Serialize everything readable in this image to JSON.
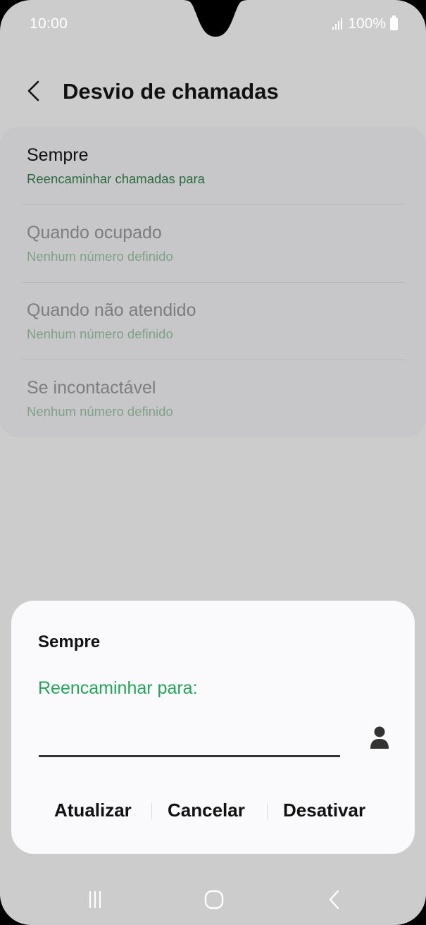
{
  "status_bar": {
    "time": "10:00",
    "battery_text": "100%",
    "signal_icon": "signal-icon",
    "battery_icon": "battery-icon"
  },
  "header": {
    "back_icon": "chevron-left-icon",
    "title": "Desvio de chamadas"
  },
  "forwarding_options": [
    {
      "title": "Sempre",
      "subtitle": "Reencaminhar chamadas para",
      "enabled": true
    },
    {
      "title": "Quando ocupado",
      "subtitle": "Nenhum número definido",
      "enabled": false
    },
    {
      "title": "Quando não atendido",
      "subtitle": "Nenhum número definido",
      "enabled": false
    },
    {
      "title": "Se incontactável",
      "subtitle": "Nenhum número definido",
      "enabled": false
    }
  ],
  "dialog": {
    "title": "Sempre",
    "label": "Reencaminhar para:",
    "number_value": "",
    "contact_icon": "person-icon",
    "buttons": {
      "update": "Atualizar",
      "cancel": "Cancelar",
      "disable": "Desativar"
    }
  },
  "nav_bar": {
    "recents_icon": "recent-apps-icon",
    "home_icon": "home-icon",
    "back_icon": "back-icon"
  },
  "colors": {
    "background": "#cccccc",
    "list_card": "#c7c7c9",
    "accent_green": "#24a45a",
    "dialog_bg": "#fafafc"
  }
}
